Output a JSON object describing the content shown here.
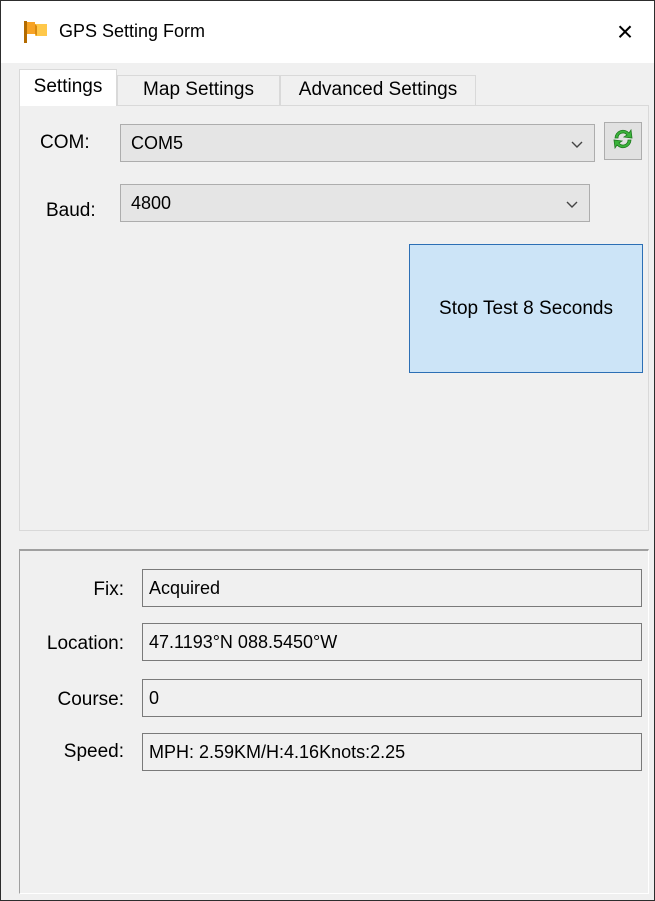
{
  "window": {
    "title": "GPS Setting Form",
    "close_glyph": "×"
  },
  "tabs": [
    {
      "label": "Settings",
      "active": true
    },
    {
      "label": "Map Settings",
      "active": false
    },
    {
      "label": "Advanced Settings",
      "active": false
    }
  ],
  "settings": {
    "com_label": "COM:",
    "com_value": "COM5",
    "baud_label": "Baud:",
    "baud_value": "4800",
    "refresh_icon": "refresh-icon",
    "stop_button_label": "Stop Test 8 Seconds"
  },
  "status": {
    "fix_label": "Fix:",
    "fix_value": "Acquired",
    "location_label": "Location:",
    "location_value": "47.1193°N 088.5450°W",
    "course_label": "Course:",
    "course_value": "0",
    "speed_label": "Speed:",
    "speed_value": "MPH: 2.59KM/H:4.16Knots:2.25"
  },
  "colors": {
    "window_bg": "#f0f0f0",
    "button_highlight": "#cce4f7",
    "button_border": "#2c6fb5",
    "refresh_green": "#3bb33b"
  }
}
